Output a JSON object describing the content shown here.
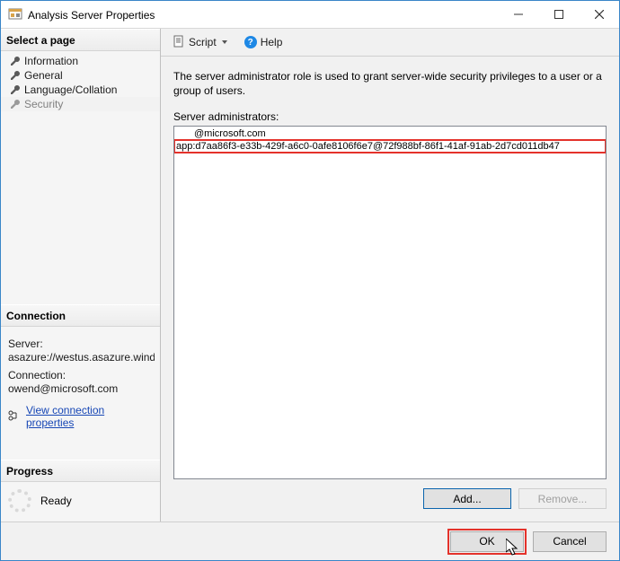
{
  "window": {
    "title": "Analysis Server Properties"
  },
  "sidebar": {
    "select_page_header": "Select a page",
    "pages": [
      {
        "label": "Information"
      },
      {
        "label": "General"
      },
      {
        "label": "Language/Collation"
      },
      {
        "label": "Security"
      }
    ],
    "connection_header": "Connection",
    "server_label": "Server:",
    "server_value": "asazure://westus.asazure.windows",
    "connection_label": "Connection:",
    "connection_value": "owend@microsoft.com",
    "view_conn_props": "View connection properties",
    "progress_header": "Progress",
    "progress_status": "Ready"
  },
  "toolbar": {
    "script_label": "Script",
    "help_label": "Help"
  },
  "main": {
    "description": "The server administrator role is used to grant server-wide security privileges to a user or a group of users.",
    "list_label": "Server administrators:",
    "admins": [
      "@microsoft.com",
      "app:d7aa86f3-e33b-429f-a6c0-0afe8106f6e7@72f988bf-86f1-41af-91ab-2d7cd011db47"
    ],
    "add_label": "Add...",
    "remove_label": "Remove..."
  },
  "footer": {
    "ok_label": "OK",
    "cancel_label": "Cancel"
  }
}
